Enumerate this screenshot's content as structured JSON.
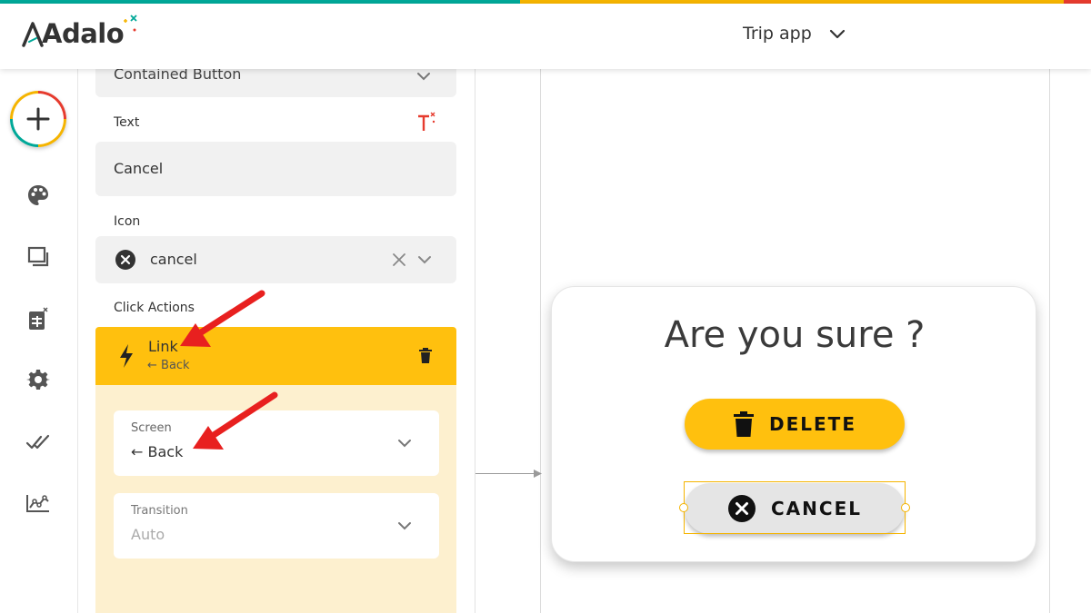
{
  "brand": {
    "logo_text": "Adalo",
    "stripe_colors": [
      "#00a898",
      "#f5b400",
      "#e63b2e"
    ],
    "accent": "#ffc00e"
  },
  "header": {
    "app_name": "Trip app",
    "app_dropdown_icon": "chevron-down-icon"
  },
  "leftrail": {
    "items": [
      {
        "name": "add-component",
        "icon": "plus-icon"
      },
      {
        "name": "branding",
        "icon": "palette-icon"
      },
      {
        "name": "screens",
        "icon": "screens-icon"
      },
      {
        "name": "database",
        "icon": "database-icon"
      },
      {
        "name": "settings",
        "icon": "gear-icon"
      },
      {
        "name": "publish",
        "icon": "double-check-icon"
      },
      {
        "name": "analytics",
        "icon": "analytics-icon"
      }
    ]
  },
  "panel": {
    "button_type_value": "Contained Button",
    "text_label": "Text",
    "text_value": "Cancel",
    "magic_text_icon": "magic-text-icon",
    "icon_label": "Icon",
    "icon_value": "cancel",
    "click_actions_label": "Click Actions",
    "action": {
      "title": "Link",
      "subtitle": "← Back",
      "icon": "lightning-icon",
      "delete_icon": "trash-icon"
    },
    "screen_field": {
      "label": "Screen",
      "value": "← Back"
    },
    "transition_field": {
      "label": "Transition",
      "value": "Auto"
    }
  },
  "canvas": {
    "modal_title": "Are you sure ?",
    "delete_button": "DELETE",
    "cancel_button": "CANCEL"
  }
}
